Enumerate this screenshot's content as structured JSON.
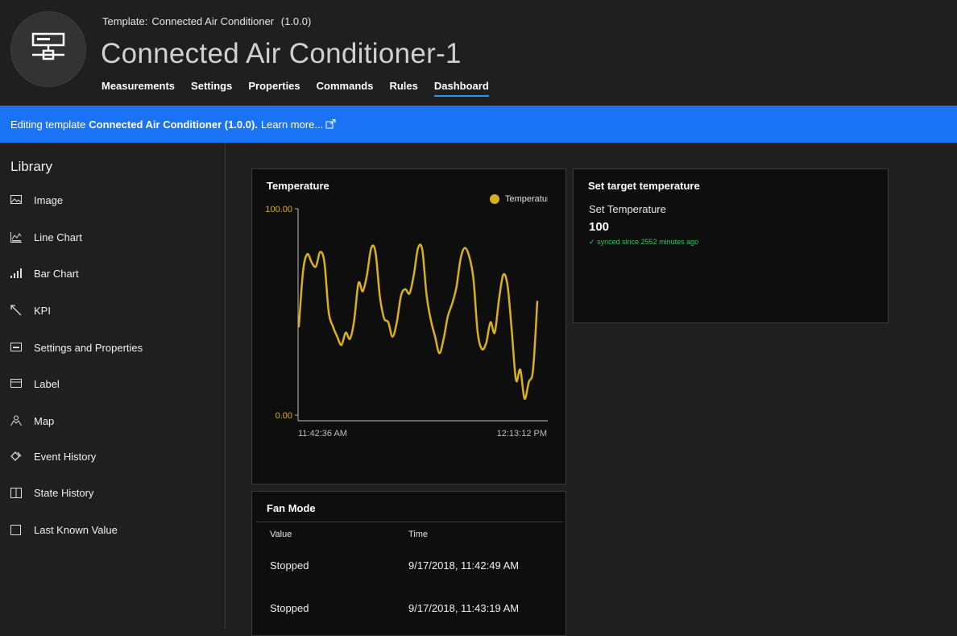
{
  "header": {
    "template_prefix": "Template:",
    "template_name": "Connected Air Conditioner",
    "template_version": "(1.0.0)",
    "device_title": "Connected Air Conditioner-1",
    "avatar_icon": "network-device-icon",
    "tabs": [
      {
        "label": "Measurements"
      },
      {
        "label": "Settings"
      },
      {
        "label": "Properties"
      },
      {
        "label": "Commands"
      },
      {
        "label": "Rules"
      },
      {
        "label": "Dashboard",
        "active": true
      }
    ]
  },
  "banner": {
    "prefix": "Editing template",
    "template": "Connected Air Conditioner (1.0.0).",
    "link": "Learn more...",
    "color": "#1a73f5"
  },
  "library": {
    "title": "Library",
    "items": [
      {
        "label": "Image",
        "icon": "image-icon"
      },
      {
        "label": "Line Chart",
        "icon": "line-chart-icon"
      },
      {
        "label": "Bar Chart",
        "icon": "bar-chart-icon"
      },
      {
        "label": "KPI",
        "icon": "kpi-arrow-icon"
      },
      {
        "label": "Settings and Properties",
        "icon": "settings-properties-icon"
      },
      {
        "label": "Label",
        "icon": "label-icon"
      },
      {
        "label": "Map",
        "icon": "map-icon"
      },
      {
        "label": "Event History",
        "icon": "event-history-icon"
      },
      {
        "label": "State History",
        "icon": "state-history-icon"
      },
      {
        "label": "Last Known Value",
        "icon": "last-known-value-icon"
      }
    ]
  },
  "temperature_tile": {
    "title": "Temperature",
    "legend": "Temperature"
  },
  "setpoint_tile": {
    "title": "Set target temperature",
    "label": "Set Temperature",
    "value": "100",
    "synced": "synced since 2552 minutes ago",
    "synced_color": "#3ec35a"
  },
  "fanmode_tile": {
    "title": "Fan Mode",
    "col_value": "Value",
    "col_time": "Time",
    "rows": [
      {
        "value": "Stopped",
        "time": "9/17/2018, 11:42:49 AM"
      },
      {
        "value": "Stopped",
        "time": "9/17/2018, 11:43:19 AM"
      }
    ]
  },
  "chart_data": {
    "type": "line",
    "title": "Temperature",
    "xlabel": "",
    "ylabel": "",
    "ylim": [
      0,
      100
    ],
    "y_ticks": [
      "0.00",
      "100.00"
    ],
    "x_ticks": [
      "11:42:36 AM",
      "12:13:12 PM"
    ],
    "legend_position": "top-right",
    "grid": false,
    "series": [
      {
        "name": "Temperature",
        "color": "#d8b11c",
        "values": [
          43,
          70,
          78,
          74,
          72,
          79,
          74,
          50,
          43,
          38,
          34,
          40,
          37,
          46,
          64,
          60,
          68,
          81,
          79,
          58,
          47,
          45,
          38,
          45,
          58,
          61,
          59,
          68,
          81,
          80,
          58,
          46,
          38,
          30,
          37,
          48,
          54,
          62,
          76,
          81,
          77,
          66,
          40,
          32,
          35,
          45,
          40,
          56,
          68,
          63,
          41,
          17,
          22,
          8,
          16,
          22,
          55
        ]
      }
    ]
  }
}
